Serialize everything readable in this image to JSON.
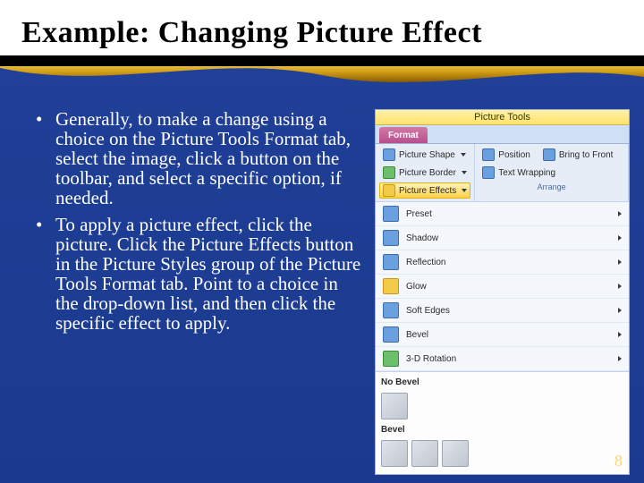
{
  "slide": {
    "title": "Example: Changing Picture Effect",
    "page_number": "8"
  },
  "bullets": [
    "Generally, to make a change using a choice on the Picture Tools Format tab, select the image, click a button on the toolbar, and select a specific option, if needed.",
    "To apply a picture effect, click the picture. Click the Picture Effects button in the Picture Styles group of the Picture Tools Format tab. Point to a choice in the drop-down list, and then click the specific effect to apply."
  ],
  "ribbon": {
    "contextual_title": "Picture Tools",
    "tab": "Format",
    "style_buttons": {
      "shape": "Picture Shape",
      "border": "Picture Border",
      "effects": "Picture Effects"
    },
    "arrange_buttons": {
      "bring_front": "Bring to Front",
      "text_wrap": "Text Wrapping",
      "position": "Position"
    },
    "arrange_label": "Arrange",
    "effect_menu": [
      "Preset",
      "Shadow",
      "Reflection",
      "Glow",
      "Soft Edges",
      "Bevel",
      "3-D Rotation"
    ],
    "submenu": {
      "no_bevel": "No Bevel",
      "bevel": "Bevel"
    }
  }
}
